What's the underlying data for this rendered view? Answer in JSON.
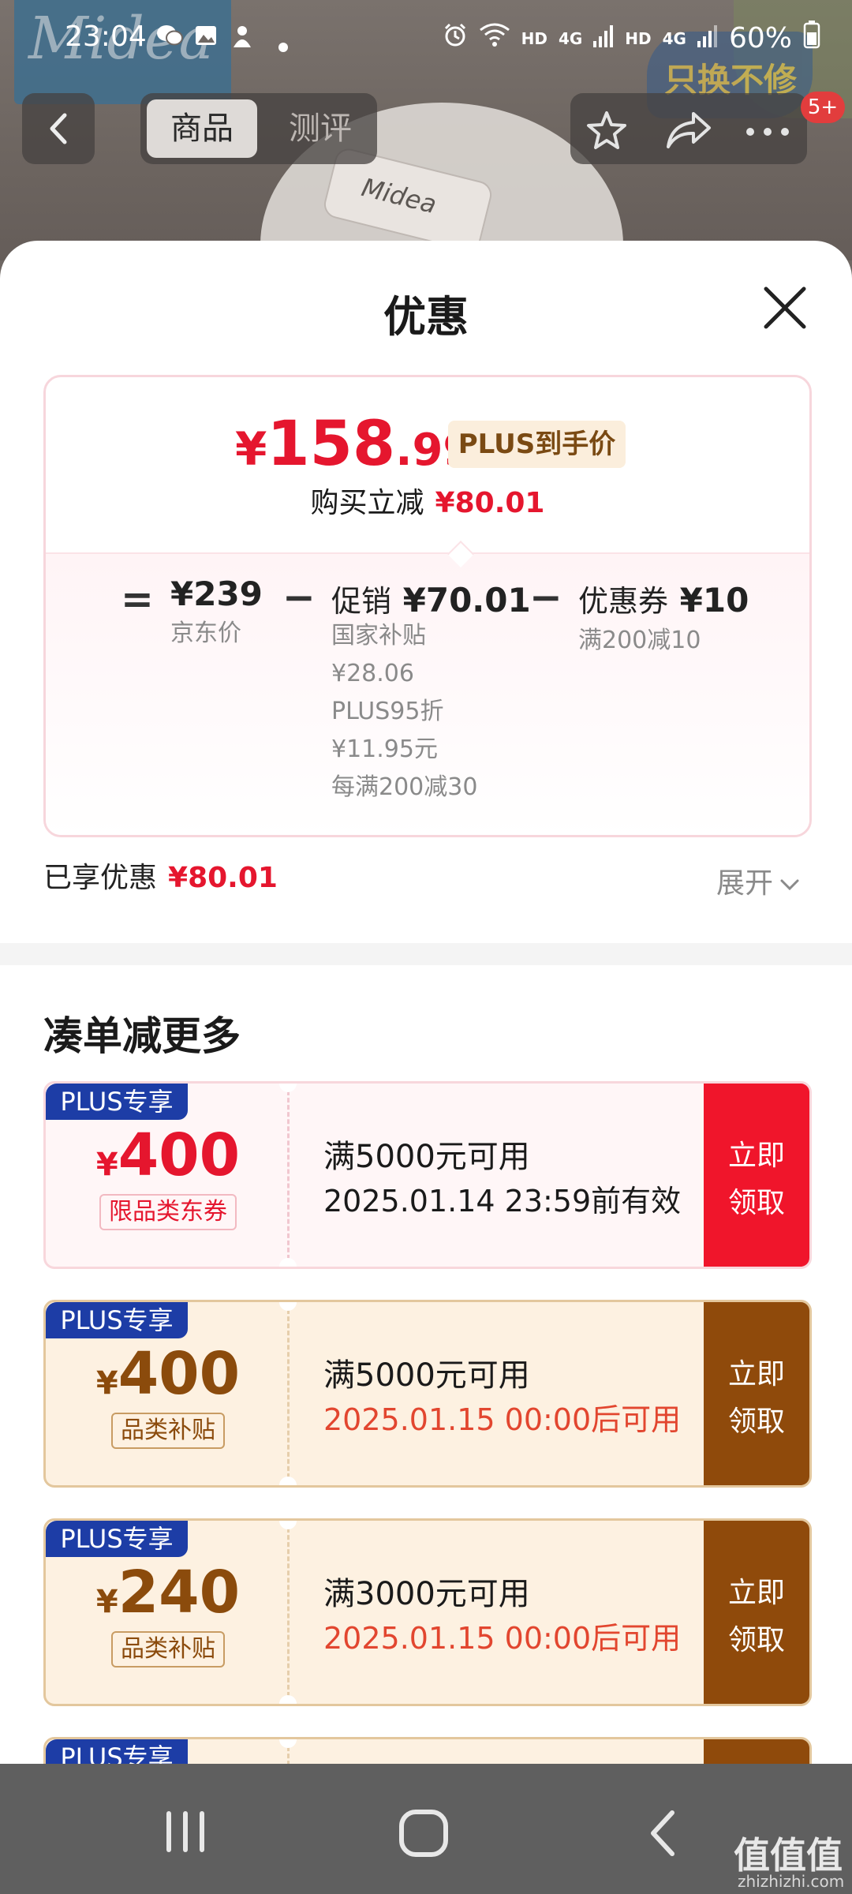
{
  "status_bar": {
    "time": "23:04",
    "hd1": "HD",
    "net1": "4G",
    "hd2": "HD",
    "net2": "4G",
    "battery": "60%"
  },
  "background": {
    "brand_text": "Midea",
    "dish_text": "Midea",
    "badge_text": "只换不修",
    "notification_count": "5+"
  },
  "nav": {
    "tab_active": "商品",
    "tab_inactive": "测评"
  },
  "sheet": {
    "title": "优惠",
    "final_price": {
      "currency": "¥",
      "integer": "158",
      "decimal": ".99",
      "tag": "PLUS到手价"
    },
    "instant_reduce_label": "购买立减",
    "instant_reduce_value": "¥80.01",
    "formula": {
      "equals": "=",
      "minus": "−",
      "jd_price": "¥239",
      "jd_price_label": "京东价",
      "promo_label": "促销",
      "promo_value": "¥70.01",
      "promo_details": [
        "国家补贴",
        "¥28.06",
        "PLUS95折",
        "¥11.95元",
        "每满200减30"
      ],
      "coupon_label": "优惠券",
      "coupon_value": "¥10",
      "coupon_detail": "满200减10"
    },
    "enjoyed_label": "已享优惠",
    "enjoyed_value": "¥80.01",
    "expand_label": "展开",
    "section_title": "凑单减更多",
    "coupons": [
      {
        "tag": "PLUS专享",
        "currency": "¥",
        "amount": "400",
        "kind": "限品类东券",
        "condition": "满5000元可用",
        "validity": "2025.01.14 23:59前有效",
        "button_line1": "立即",
        "button_line2": "领取"
      },
      {
        "tag": "PLUS专享",
        "currency": "¥",
        "amount": "400",
        "kind": "品类补贴",
        "condition": "满5000元可用",
        "validity": "2025.01.15 00:00后可用",
        "button_line1": "立即",
        "button_line2": "领取"
      },
      {
        "tag": "PLUS专享",
        "currency": "¥",
        "amount": "240",
        "kind": "品类补贴",
        "condition": "满3000元可用",
        "validity": "2025.01.15 00:00后可用",
        "button_line1": "立即",
        "button_line2": "领取"
      },
      {
        "tag": "PLUS专享"
      }
    ]
  },
  "watermark": {
    "text": "值值值",
    "domain": "zhizhizhi.com"
  },
  "colors": {
    "price_red": "#e5162e",
    "plus_blue": "#1d3da6",
    "gold_brown": "#8f4a0b",
    "coupon_red_button": "#f0152b"
  }
}
